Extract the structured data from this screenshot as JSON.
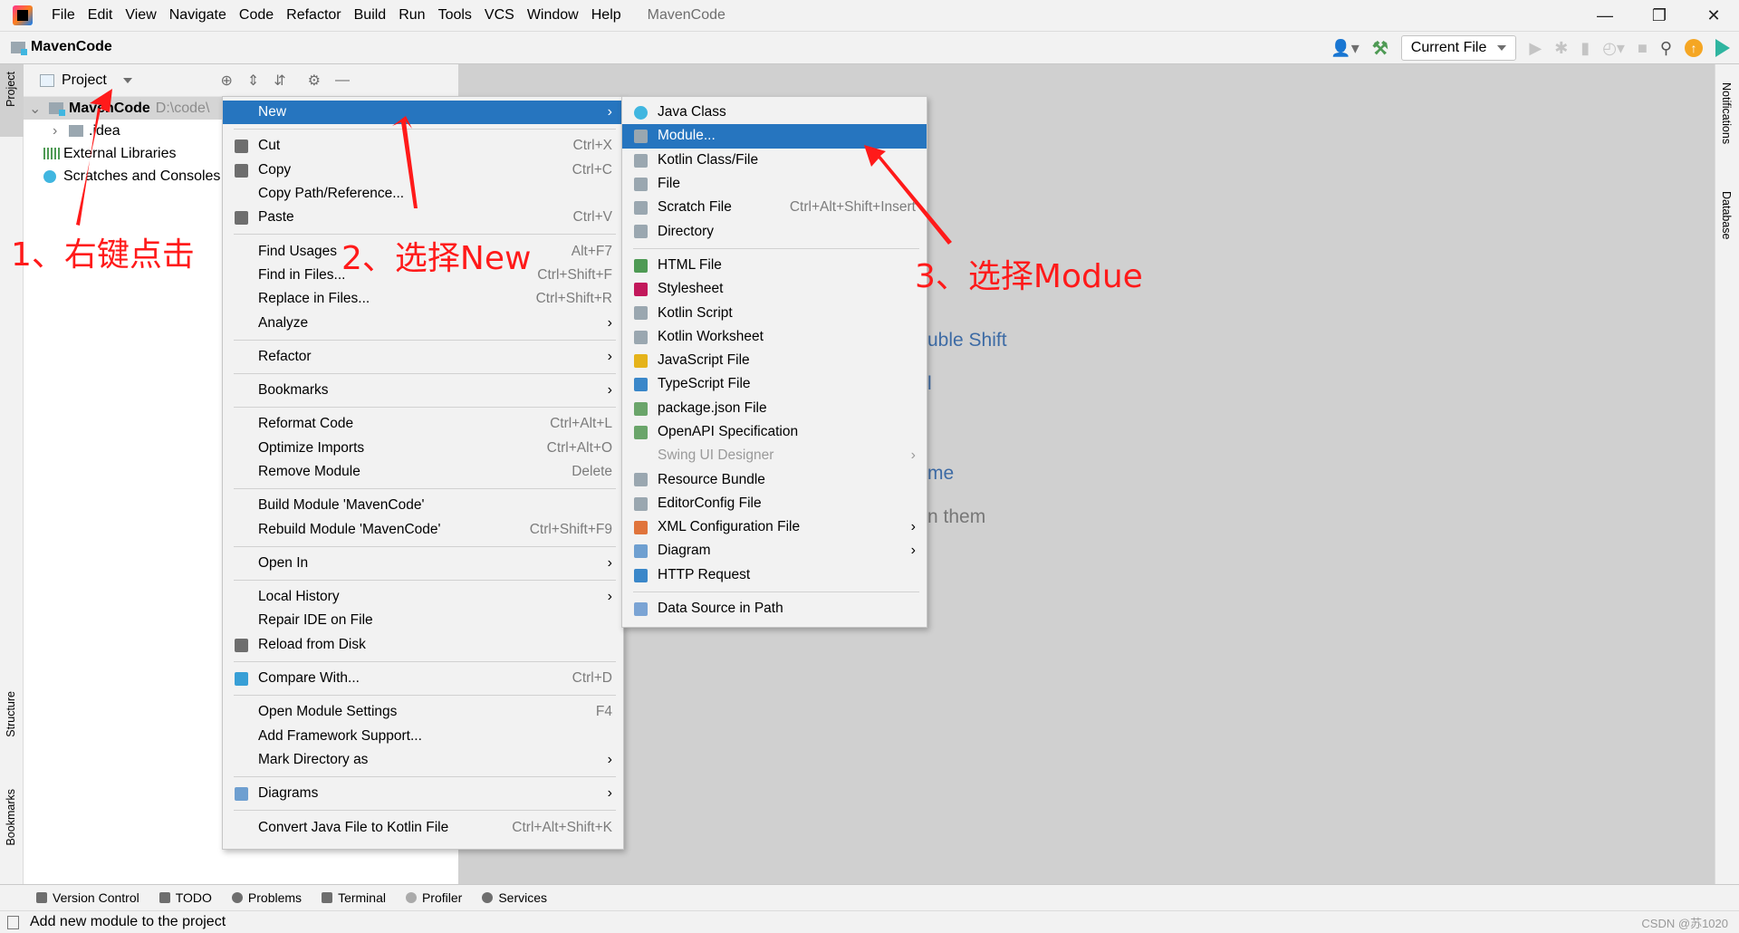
{
  "menubar": {
    "items": [
      "File",
      "Edit",
      "View",
      "Navigate",
      "Code",
      "Refactor",
      "Build",
      "Run",
      "Tools",
      "VCS",
      "Window",
      "Help"
    ],
    "title": "MavenCode"
  },
  "toolbar": {
    "project": "MavenCode",
    "run_config": "Current File"
  },
  "left_strip": {
    "project": "Project",
    "structure": "Structure",
    "bookmarks": "Bookmarks"
  },
  "right_strip": {
    "notifications": "Notifications",
    "database": "Database"
  },
  "project_panel": {
    "title": "Project",
    "root": "MavenCode",
    "root_path": "D:\\code\\",
    "items": [
      ".idea",
      "External Libraries",
      "Scratches and Consoles"
    ]
  },
  "context_menu": [
    {
      "label": "New",
      "submenu": true,
      "highlight": true
    },
    {
      "sep": true
    },
    {
      "label": "Cut",
      "shortcut": "Ctrl+X",
      "icon": "scissors"
    },
    {
      "label": "Copy",
      "shortcut": "Ctrl+C",
      "icon": "copy"
    },
    {
      "label": "Copy Path/Reference..."
    },
    {
      "label": "Paste",
      "shortcut": "Ctrl+V",
      "icon": "paste"
    },
    {
      "sep": true
    },
    {
      "label": "Find Usages",
      "shortcut": "Alt+F7"
    },
    {
      "label": "Find in Files...",
      "shortcut": "Ctrl+Shift+F"
    },
    {
      "label": "Replace in Files...",
      "shortcut": "Ctrl+Shift+R"
    },
    {
      "label": "Analyze",
      "submenu": true
    },
    {
      "sep": true
    },
    {
      "label": "Refactor",
      "submenu": true
    },
    {
      "sep": true
    },
    {
      "label": "Bookmarks",
      "submenu": true
    },
    {
      "sep": true
    },
    {
      "label": "Reformat Code",
      "shortcut": "Ctrl+Alt+L"
    },
    {
      "label": "Optimize Imports",
      "shortcut": "Ctrl+Alt+O"
    },
    {
      "label": "Remove Module",
      "shortcut": "Delete"
    },
    {
      "sep": true
    },
    {
      "label": "Build Module 'MavenCode'"
    },
    {
      "label": "Rebuild Module 'MavenCode'",
      "shortcut": "Ctrl+Shift+F9"
    },
    {
      "sep": true
    },
    {
      "label": "Open In",
      "submenu": true
    },
    {
      "sep": true
    },
    {
      "label": "Local History",
      "submenu": true
    },
    {
      "label": "Repair IDE on File"
    },
    {
      "label": "Reload from Disk",
      "icon": "reload"
    },
    {
      "sep": true
    },
    {
      "label": "Compare With...",
      "shortcut": "Ctrl+D",
      "icon": "compare"
    },
    {
      "sep": true
    },
    {
      "label": "Open Module Settings",
      "shortcut": "F4"
    },
    {
      "label": "Add Framework Support..."
    },
    {
      "label": "Mark Directory as",
      "submenu": true
    },
    {
      "sep": true
    },
    {
      "label": "Diagrams",
      "submenu": true,
      "icon": "diagram"
    },
    {
      "sep": true
    },
    {
      "label": "Convert Java File to Kotlin File",
      "shortcut": "Ctrl+Alt+Shift+K"
    }
  ],
  "new_submenu": [
    {
      "label": "Java Class",
      "icon": "java-class"
    },
    {
      "label": "Module...",
      "icon": "module",
      "highlight": true
    },
    {
      "label": "Kotlin Class/File",
      "icon": "kotlin"
    },
    {
      "label": "File",
      "icon": "file"
    },
    {
      "label": "Scratch File",
      "shortcut": "Ctrl+Alt+Shift+Insert",
      "icon": "scratch"
    },
    {
      "label": "Directory",
      "icon": "folder"
    },
    {
      "sep": true
    },
    {
      "label": "HTML File",
      "icon": "html"
    },
    {
      "label": "Stylesheet",
      "icon": "css"
    },
    {
      "label": "Kotlin Script",
      "icon": "kotlin"
    },
    {
      "label": "Kotlin Worksheet",
      "icon": "kotlin"
    },
    {
      "label": "JavaScript File",
      "icon": "js"
    },
    {
      "label": "TypeScript File",
      "icon": "ts"
    },
    {
      "label": "package.json File",
      "icon": "npm"
    },
    {
      "label": "OpenAPI Specification",
      "icon": "openapi"
    },
    {
      "label": "Swing UI Designer",
      "submenu": true,
      "disabled": true
    },
    {
      "label": "Resource Bundle",
      "icon": "bundle"
    },
    {
      "label": "EditorConfig File",
      "icon": "gear"
    },
    {
      "label": "XML Configuration File",
      "submenu": true,
      "icon": "xml"
    },
    {
      "label": "Diagram",
      "submenu": true,
      "icon": "diagram"
    },
    {
      "label": "HTTP Request",
      "icon": "api"
    },
    {
      "sep": true
    },
    {
      "label": "Data Source in Path",
      "icon": "database"
    }
  ],
  "editor_hints": [
    "uble Shift",
    "l",
    "me",
    "n them"
  ],
  "bottom_tools": [
    "Version Control",
    "TODO",
    "Problems",
    "Terminal",
    "Profiler",
    "Services"
  ],
  "status": {
    "message": "Add new module to the project",
    "watermark": "CSDN @苏1020"
  },
  "annotations": {
    "step1": "1、右键点击",
    "step2": "2、选择New",
    "step3": "3、选择Modue",
    "color": "#ff1a1a"
  },
  "colors": {
    "highlight": "#2675bf",
    "editor_bg": "#d0d0d0"
  }
}
